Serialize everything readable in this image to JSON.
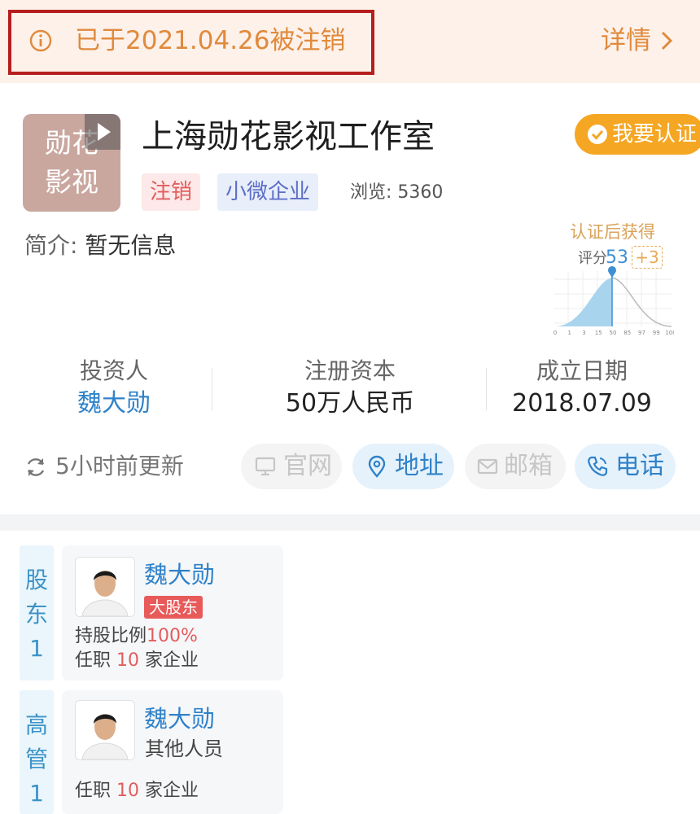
{
  "banner": {
    "notice": "已于2021.04.26被注销",
    "details_label": "详情"
  },
  "company": {
    "logo_text": "勋花\n影视",
    "name": "上海勋花影视工作室",
    "certify_label": "我要认证",
    "tags": [
      "注销",
      "小微企业"
    ],
    "views_label": "浏览:",
    "views_value": "5360",
    "intro_label": "简介:",
    "intro_value": "暂无信息"
  },
  "score": {
    "cert_text": "认证后获得",
    "label": "评分",
    "value": "53",
    "bonus": "+3",
    "axis_ticks": [
      "0",
      "1",
      "3",
      "15",
      "50",
      "85",
      "97",
      "99",
      "100"
    ]
  },
  "stats": [
    {
      "label": "投资人",
      "value": "魏大勋"
    },
    {
      "label": "注册资本",
      "value": "50万人民币"
    },
    {
      "label": "成立日期",
      "value": "2018.07.09"
    }
  ],
  "update_text": "5小时前更新",
  "actions": [
    {
      "label": "官网",
      "icon": "monitor-icon",
      "enabled": false
    },
    {
      "label": "地址",
      "icon": "location-pin-icon",
      "enabled": true
    },
    {
      "label": "邮箱",
      "icon": "mail-icon",
      "enabled": false
    },
    {
      "label": "电话",
      "icon": "phone-icon",
      "enabled": true
    }
  ],
  "shareholders": {
    "tab_chars": [
      "股",
      "东",
      "1"
    ],
    "person": {
      "name": "魏大勋",
      "badge": "大股东",
      "ratio_label": "持股比例",
      "ratio_value": "100%",
      "jobs_prefix": "任职",
      "jobs_count": "10",
      "jobs_suffix": "家企业"
    }
  },
  "executives": {
    "tab_chars": [
      "高",
      "管",
      "1"
    ],
    "person": {
      "name": "魏大勋",
      "role": "其他人员",
      "jobs_prefix": "任职",
      "jobs_count": "10",
      "jobs_suffix": "家企业"
    }
  },
  "colors": {
    "accent_orange": "#e08a3c",
    "certify_orange": "#f5a623",
    "link_blue": "#2f82c9",
    "warning_red": "#e25d5d",
    "highlight_border": "#b61e1e"
  }
}
